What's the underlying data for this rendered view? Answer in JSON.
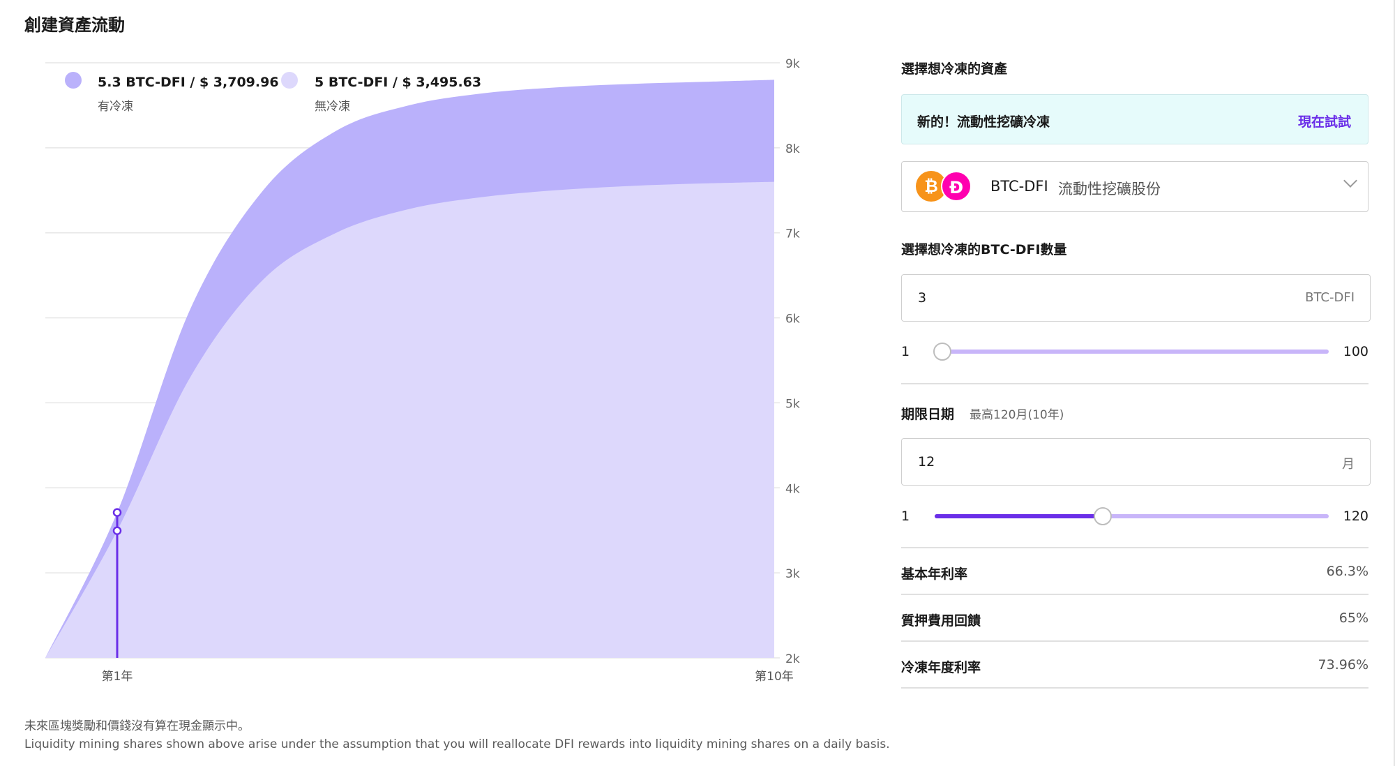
{
  "page": {
    "title": "創建資產流動"
  },
  "chart_data": {
    "type": "area",
    "x": [
      1,
      2,
      3,
      4,
      5,
      6,
      7,
      8,
      9,
      10
    ],
    "x_tick_labels": [
      "第1年",
      "第10年"
    ],
    "yticks": [
      "9k",
      "8k",
      "7k",
      "6k",
      "5k",
      "4k",
      "3k",
      "2k"
    ],
    "ylim": [
      2000,
      9000
    ],
    "series": [
      {
        "name": "有冷凍",
        "color": "#bab1fb",
        "values": [
          3709.96,
          6100,
          7500,
          8200,
          8500,
          8640,
          8710,
          8750,
          8775,
          8800
        ],
        "start": 2000
      },
      {
        "name": "無冷凍",
        "color": "#ddd8fc",
        "values": [
          3495.63,
          5300,
          6450,
          7000,
          7280,
          7420,
          7500,
          7550,
          7580,
          7600
        ],
        "start": 2000
      }
    ],
    "marker": {
      "x": 1,
      "values": [
        3709.96,
        3495.63
      ],
      "color": "#6a2ee8"
    },
    "legend": [
      {
        "main": "5.3 BTC-DFI / $ 3,709.96",
        "sub": "有冷凍",
        "color": "#bab1fb"
      },
      {
        "main": "5 BTC-DFI / $ 3,495.63",
        "sub": "無冷凍",
        "color": "#ddd8fc"
      }
    ]
  },
  "footnotes": {
    "line1": "未來區塊獎勵和價錢沒有算在現金顯示中。",
    "line2": "Liquidity mining shares shown above arise under the assumption that you will reallocate DFI rewards into liquidity mining shares on a daily basis."
  },
  "panel": {
    "asset_label": "選擇想冷凍的資產",
    "promo": {
      "text": "新的！流動性挖礦冷凍",
      "link": "現在試試"
    },
    "asset_select": {
      "name": "BTC-DFI",
      "desc": "流動性挖礦股份",
      "icons": [
        "bitcoin-icon",
        "defichain-icon"
      ]
    },
    "amount": {
      "label": "選擇想冷凍的BTC-DFI數量",
      "value": "3",
      "unit": "BTC-DFI",
      "min": "1",
      "max": "100",
      "fraction": 0.02
    },
    "term": {
      "label": "期限日期",
      "hint": "最高120月(10年)",
      "value": "12",
      "unit": "月",
      "min": "1",
      "max": "120",
      "fraction": 0.426
    },
    "stats": [
      {
        "label": "基本年利率",
        "value": "66.3%"
      },
      {
        "label": "質押費用回饋",
        "value": "65%"
      },
      {
        "label": "冷凍年度利率",
        "value": "73.96%"
      }
    ],
    "colors": {
      "accent": "#6a2ee8",
      "promo_bg": "#e6fbfb"
    }
  }
}
